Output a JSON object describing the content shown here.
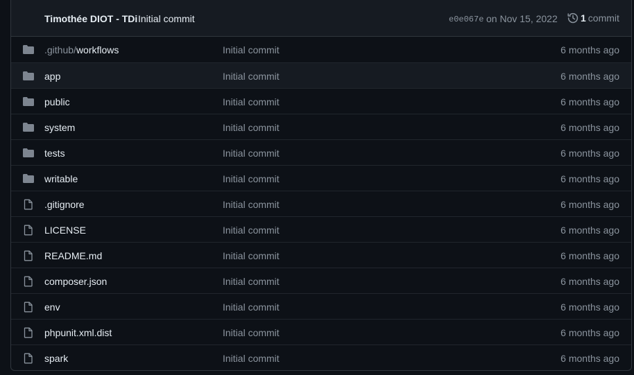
{
  "header": {
    "author": "Timothée DIOT - TDi",
    "message": "Initial commit",
    "sha": "e0e067e",
    "date": "on Nov 15, 2022",
    "commit_count": "1",
    "commit_label": "commit"
  },
  "files": [
    {
      "type": "folder",
      "prefix": ".github/",
      "name": "workflows",
      "message": "Initial commit",
      "age": "6 months ago"
    },
    {
      "type": "folder",
      "prefix": "",
      "name": "app",
      "message": "Initial commit",
      "age": "6 months ago"
    },
    {
      "type": "folder",
      "prefix": "",
      "name": "public",
      "message": "Initial commit",
      "age": "6 months ago"
    },
    {
      "type": "folder",
      "prefix": "",
      "name": "system",
      "message": "Initial commit",
      "age": "6 months ago"
    },
    {
      "type": "folder",
      "prefix": "",
      "name": "tests",
      "message": "Initial commit",
      "age": "6 months ago"
    },
    {
      "type": "folder",
      "prefix": "",
      "name": "writable",
      "message": "Initial commit",
      "age": "6 months ago"
    },
    {
      "type": "file",
      "prefix": "",
      "name": ".gitignore",
      "message": "Initial commit",
      "age": "6 months ago"
    },
    {
      "type": "file",
      "prefix": "",
      "name": "LICENSE",
      "message": "Initial commit",
      "age": "6 months ago"
    },
    {
      "type": "file",
      "prefix": "",
      "name": "README.md",
      "message": "Initial commit",
      "age": "6 months ago"
    },
    {
      "type": "file",
      "prefix": "",
      "name": "composer.json",
      "message": "Initial commit",
      "age": "6 months ago"
    },
    {
      "type": "file",
      "prefix": "",
      "name": "env",
      "message": "Initial commit",
      "age": "6 months ago"
    },
    {
      "type": "file",
      "prefix": "",
      "name": "phpunit.xml.dist",
      "message": "Initial commit",
      "age": "6 months ago"
    },
    {
      "type": "file",
      "prefix": "",
      "name": "spark",
      "message": "Initial commit",
      "age": "6 months ago"
    }
  ],
  "colors": {
    "background": "#0d1117",
    "header_bg": "#161b22",
    "icon": "#7d8590",
    "muted_text": "#8b949e"
  }
}
